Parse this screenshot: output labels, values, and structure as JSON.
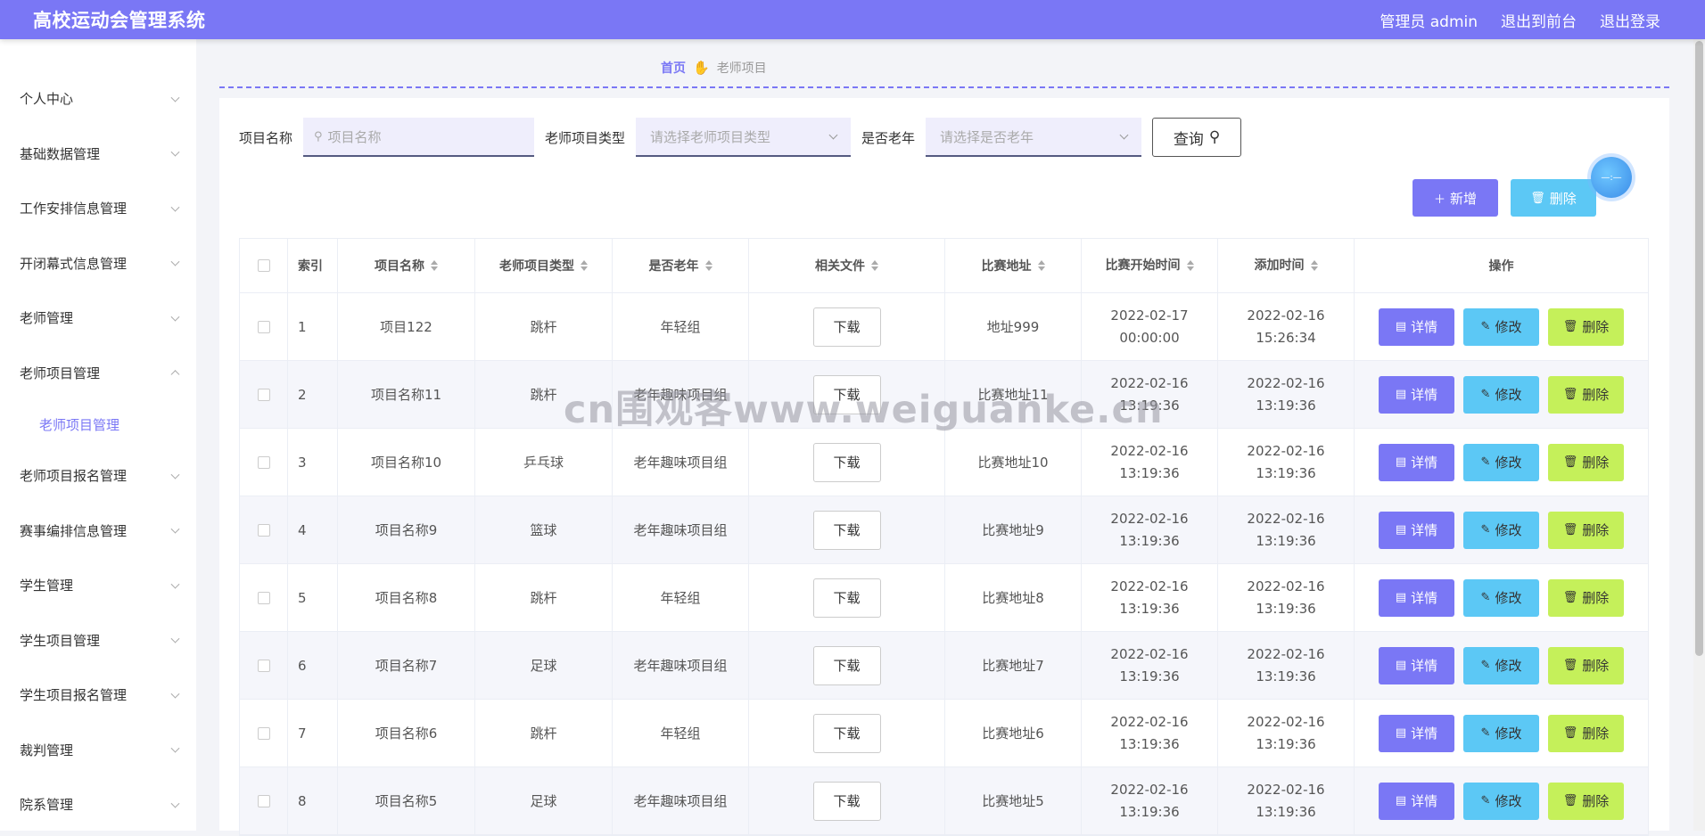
{
  "header": {
    "title": "高校运动会管理系统",
    "admin": "管理员 admin",
    "to_front": "退出到前台",
    "logout": "退出登录"
  },
  "sidebar": {
    "items": [
      {
        "label": "个人中心"
      },
      {
        "label": "基础数据管理"
      },
      {
        "label": "工作安排信息管理"
      },
      {
        "label": "开闭幕式信息管理"
      },
      {
        "label": "老师管理"
      },
      {
        "label": "老师项目管理",
        "expanded": true,
        "sub": "老师项目管理"
      },
      {
        "label": "老师项目报名管理"
      },
      {
        "label": "赛事编排信息管理"
      },
      {
        "label": "学生管理"
      },
      {
        "label": "学生项目管理"
      },
      {
        "label": "学生项目报名管理"
      },
      {
        "label": "裁判管理"
      },
      {
        "label": "院系管理"
      }
    ]
  },
  "breadcrumb": {
    "home": "首页",
    "current": "老师项目"
  },
  "search": {
    "name_label": "项目名称",
    "name_placeholder": "项目名称",
    "type_label": "老师项目类型",
    "type_placeholder": "请选择老师项目类型",
    "old_label": "是否老年",
    "old_placeholder": "请选择是否老年",
    "query_label": "查询"
  },
  "actions": {
    "add": "新增",
    "delete": "删除"
  },
  "table": {
    "columns": [
      "索引",
      "项目名称",
      "老师项目类型",
      "是否老年",
      "相关文件",
      "比赛地址",
      "比赛开始时间",
      "添加时间",
      "操作"
    ],
    "download_label": "下载",
    "op_detail": "详情",
    "op_edit": "修改",
    "op_delete": "删除",
    "rows": [
      {
        "idx": "1",
        "name": "项目122",
        "type": "跳杆",
        "old": "年轻组",
        "addr": "地址999",
        "start": "2022-02-17 00:00:00",
        "added": "2022-02-16 15:26:34"
      },
      {
        "idx": "2",
        "name": "项目名称11",
        "type": "跳杆",
        "old": "老年趣味项目组",
        "addr": "比赛地址11",
        "start": "2022-02-16 13:19:36",
        "added": "2022-02-16 13:19:36"
      },
      {
        "idx": "3",
        "name": "项目名称10",
        "type": "乒乓球",
        "old": "老年趣味项目组",
        "addr": "比赛地址10",
        "start": "2022-02-16 13:19:36",
        "added": "2022-02-16 13:19:36"
      },
      {
        "idx": "4",
        "name": "项目名称9",
        "type": "篮球",
        "old": "老年趣味项目组",
        "addr": "比赛地址9",
        "start": "2022-02-16 13:19:36",
        "added": "2022-02-16 13:19:36"
      },
      {
        "idx": "5",
        "name": "项目名称8",
        "type": "跳杆",
        "old": "年轻组",
        "addr": "比赛地址8",
        "start": "2022-02-16 13:19:36",
        "added": "2022-02-16 13:19:36"
      },
      {
        "idx": "6",
        "name": "项目名称7",
        "type": "足球",
        "old": "老年趣味项目组",
        "addr": "比赛地址7",
        "start": "2022-02-16 13:19:36",
        "added": "2022-02-16 13:19:36"
      },
      {
        "idx": "7",
        "name": "项目名称6",
        "type": "跳杆",
        "old": "年轻组",
        "addr": "比赛地址6",
        "start": "2022-02-16 13:19:36",
        "added": "2022-02-16 13:19:36"
      },
      {
        "idx": "8",
        "name": "项目名称5",
        "type": "足球",
        "old": "老年趣味项目组",
        "addr": "比赛地址5",
        "start": "2022-02-16 13:19:36",
        "added": "2022-02-16 13:19:36"
      }
    ]
  },
  "watermark": "cn围观客www.weiguanke.cn",
  "colors": {
    "primary": "#7a77f5",
    "info": "#5cc8f5",
    "lime": "#c5f05a"
  }
}
